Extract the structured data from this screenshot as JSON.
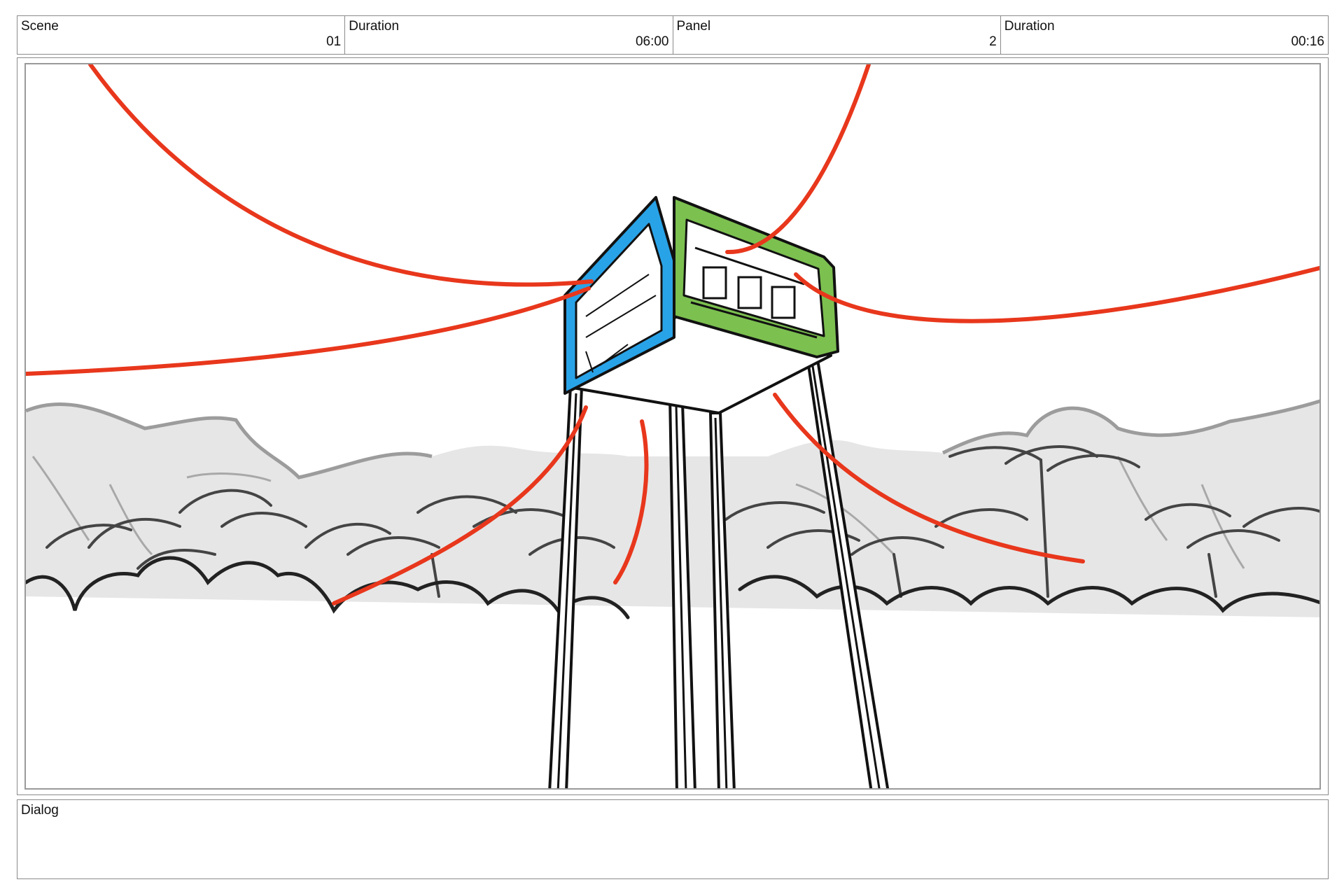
{
  "header": {
    "cells": [
      {
        "label": "Scene",
        "value": "01"
      },
      {
        "label": "Duration",
        "value": "06:00"
      },
      {
        "label": "Panel",
        "value": "2"
      },
      {
        "label": "Duration",
        "value": "00:16"
      }
    ]
  },
  "dialog": {
    "label": "Dialog",
    "text": ""
  },
  "colors": {
    "camera_lines": "#e8371c",
    "tower_left_face": "#29a3e8",
    "tower_right_face": "#7cc050",
    "background_fill": "#e6e6e6",
    "ink": "#1a1a1a"
  }
}
